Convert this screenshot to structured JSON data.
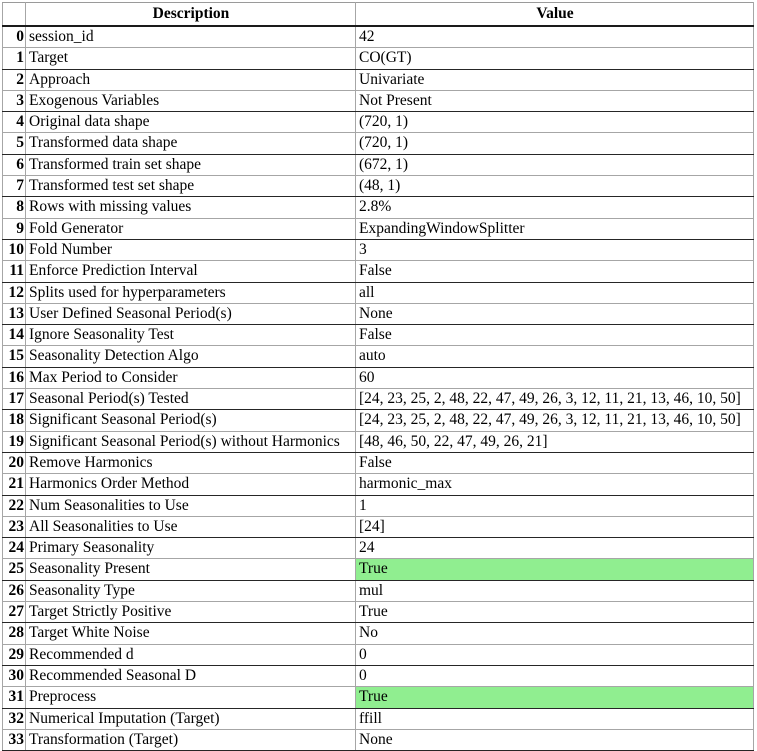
{
  "table": {
    "columns": [
      "",
      "Description",
      "Value"
    ],
    "highlight_color": "#90ee90",
    "rows": [
      {
        "index": "0",
        "description": "session_id",
        "value": "42",
        "highlight": false
      },
      {
        "index": "1",
        "description": "Target",
        "value": "CO(GT)",
        "highlight": false
      },
      {
        "index": "2",
        "description": "Approach",
        "value": "Univariate",
        "highlight": false
      },
      {
        "index": "3",
        "description": "Exogenous Variables",
        "value": "Not Present",
        "highlight": false
      },
      {
        "index": "4",
        "description": "Original data shape",
        "value": "(720, 1)",
        "highlight": false
      },
      {
        "index": "5",
        "description": "Transformed data shape",
        "value": "(720, 1)",
        "highlight": false
      },
      {
        "index": "6",
        "description": "Transformed train set shape",
        "value": "(672, 1)",
        "highlight": false
      },
      {
        "index": "7",
        "description": "Transformed test set shape",
        "value": "(48, 1)",
        "highlight": false
      },
      {
        "index": "8",
        "description": "Rows with missing values",
        "value": "2.8%",
        "highlight": false
      },
      {
        "index": "9",
        "description": "Fold Generator",
        "value": "ExpandingWindowSplitter",
        "highlight": false
      },
      {
        "index": "10",
        "description": "Fold Number",
        "value": "3",
        "highlight": false
      },
      {
        "index": "11",
        "description": "Enforce Prediction Interval",
        "value": "False",
        "highlight": false
      },
      {
        "index": "12",
        "description": "Splits used for hyperparameters",
        "value": "all",
        "highlight": false
      },
      {
        "index": "13",
        "description": "User Defined Seasonal Period(s)",
        "value": "None",
        "highlight": false
      },
      {
        "index": "14",
        "description": "Ignore Seasonality Test",
        "value": "False",
        "highlight": false
      },
      {
        "index": "15",
        "description": "Seasonality Detection Algo",
        "value": "auto",
        "highlight": false
      },
      {
        "index": "16",
        "description": "Max Period to Consider",
        "value": "60",
        "highlight": false
      },
      {
        "index": "17",
        "description": "Seasonal Period(s) Tested",
        "value": "[24, 23, 25, 2, 48, 22, 47, 49, 26, 3, 12, 11, 21, 13, 46, 10, 50]",
        "highlight": false
      },
      {
        "index": "18",
        "description": "Significant Seasonal Period(s)",
        "value": "[24, 23, 25, 2, 48, 22, 47, 49, 26, 3, 12, 11, 21, 13, 46, 10, 50]",
        "highlight": false
      },
      {
        "index": "19",
        "description": "Significant Seasonal Period(s) without Harmonics",
        "value": "[48, 46, 50, 22, 47, 49, 26, 21]",
        "highlight": false
      },
      {
        "index": "20",
        "description": "Remove Harmonics",
        "value": "False",
        "highlight": false
      },
      {
        "index": "21",
        "description": "Harmonics Order Method",
        "value": "harmonic_max",
        "highlight": false
      },
      {
        "index": "22",
        "description": "Num Seasonalities to Use",
        "value": "1",
        "highlight": false
      },
      {
        "index": "23",
        "description": "All Seasonalities to Use",
        "value": "[24]",
        "highlight": false
      },
      {
        "index": "24",
        "description": "Primary Seasonality",
        "value": "24",
        "highlight": false
      },
      {
        "index": "25",
        "description": "Seasonality Present",
        "value": "True",
        "highlight": true
      },
      {
        "index": "26",
        "description": "Seasonality Type",
        "value": "mul",
        "highlight": false
      },
      {
        "index": "27",
        "description": "Target Strictly Positive",
        "value": "True",
        "highlight": false
      },
      {
        "index": "28",
        "description": "Target White Noise",
        "value": "No",
        "highlight": false
      },
      {
        "index": "29",
        "description": "Recommended d",
        "value": "0",
        "highlight": false
      },
      {
        "index": "30",
        "description": "Recommended Seasonal D",
        "value": "0",
        "highlight": false
      },
      {
        "index": "31",
        "description": "Preprocess",
        "value": "True",
        "highlight": true
      },
      {
        "index": "32",
        "description": "Numerical Imputation (Target)",
        "value": "ffill",
        "highlight": false
      },
      {
        "index": "33",
        "description": "Transformation (Target)",
        "value": "None",
        "highlight": false
      }
    ]
  }
}
